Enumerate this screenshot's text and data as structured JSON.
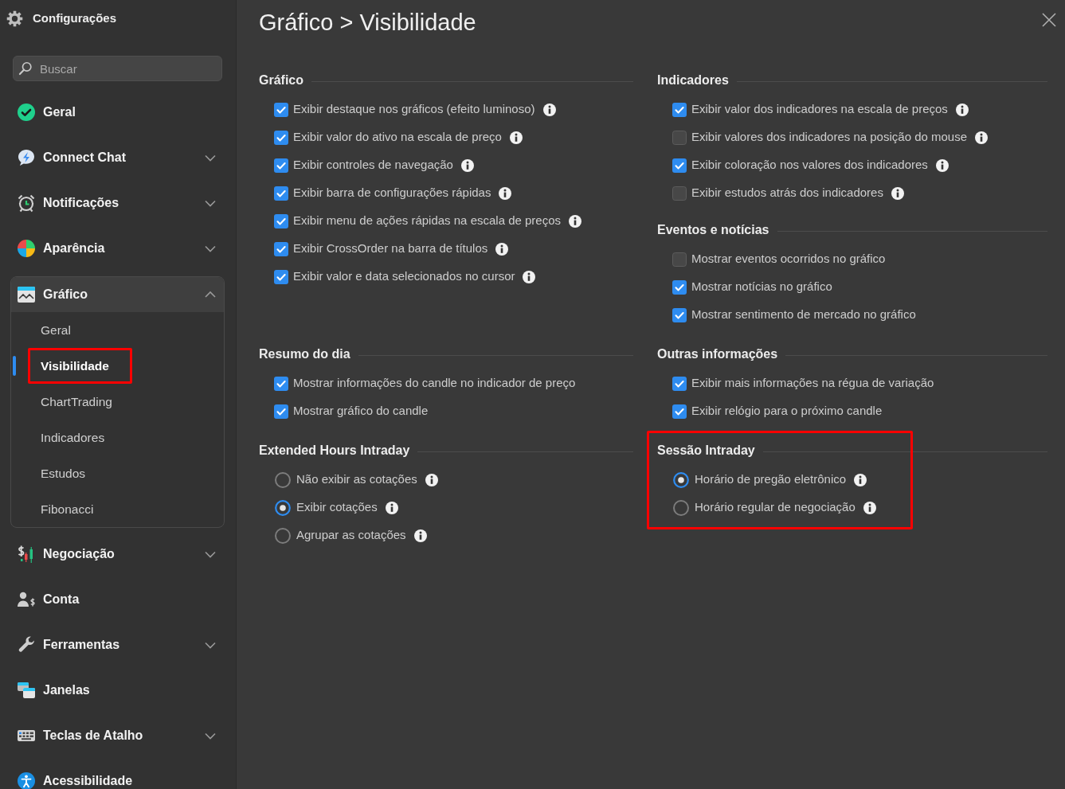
{
  "sidebar": {
    "title": "Configurações",
    "search": {
      "placeholder": "Buscar"
    },
    "items": [
      {
        "label": "Geral",
        "expandable": false,
        "expanded": false
      },
      {
        "label": "Connect Chat",
        "expandable": true,
        "expanded": false
      },
      {
        "label": "Notificações",
        "expandable": true,
        "expanded": false
      },
      {
        "label": "Aparência",
        "expandable": true,
        "expanded": false
      },
      {
        "label": "Gráfico",
        "expandable": true,
        "expanded": true,
        "children": [
          {
            "label": "Geral",
            "selected": false,
            "highlighted": false
          },
          {
            "label": "Visibilidade",
            "selected": true,
            "highlighted": true
          },
          {
            "label": "ChartTrading",
            "selected": false,
            "highlighted": false
          },
          {
            "label": "Indicadores",
            "selected": false,
            "highlighted": false
          },
          {
            "label": "Estudos",
            "selected": false,
            "highlighted": false
          },
          {
            "label": "Fibonacci",
            "selected": false,
            "highlighted": false
          }
        ]
      },
      {
        "label": "Negociação",
        "expandable": true,
        "expanded": false
      },
      {
        "label": "Conta",
        "expandable": false,
        "expanded": false
      },
      {
        "label": "Ferramentas",
        "expandable": true,
        "expanded": false
      },
      {
        "label": "Janelas",
        "expandable": false,
        "expanded": false
      },
      {
        "label": "Teclas de Atalho",
        "expandable": true,
        "expanded": false
      },
      {
        "label": "Acessibilidade",
        "expandable": false,
        "expanded": false
      }
    ]
  },
  "page": {
    "title": "Gráfico > Visibilidade",
    "rows": [
      {
        "left": [
          {
            "title": "Gráfico",
            "highlighted": false,
            "options": [
              {
                "kind": "checkbox",
                "label": "Exibir destaque nos gráficos (efeito luminoso)",
                "checked": true,
                "info": true
              },
              {
                "kind": "checkbox",
                "label": "Exibir valor do ativo na escala de preço",
                "checked": true,
                "info": true
              },
              {
                "kind": "checkbox",
                "label": "Exibir controles de navegação",
                "checked": true,
                "info": true
              },
              {
                "kind": "checkbox",
                "label": "Exibir barra de configurações rápidas",
                "checked": true,
                "info": true
              },
              {
                "kind": "checkbox",
                "label": "Exibir menu de ações rápidas na escala de preços",
                "checked": true,
                "info": true
              },
              {
                "kind": "checkbox",
                "label": "Exibir CrossOrder na barra de títulos",
                "checked": true,
                "info": true
              },
              {
                "kind": "checkbox",
                "label": "Exibir valor e data selecionados no cursor",
                "checked": true,
                "info": true
              }
            ]
          }
        ],
        "right": [
          {
            "title": "Indicadores",
            "highlighted": false,
            "options": [
              {
                "kind": "checkbox",
                "label": "Exibir valor dos indicadores na escala de preços",
                "checked": true,
                "info": true
              },
              {
                "kind": "checkbox",
                "label": "Exibir valores dos indicadores na posição do mouse",
                "checked": false,
                "info": true
              },
              {
                "kind": "checkbox",
                "label": "Exibir coloração nos valores dos indicadores",
                "checked": true,
                "info": true
              },
              {
                "kind": "checkbox",
                "label": "Exibir estudos atrás dos indicadores",
                "checked": false,
                "info": true
              }
            ]
          },
          {
            "title": "Eventos e notícias",
            "highlighted": false,
            "options": [
              {
                "kind": "checkbox",
                "label": "Mostrar eventos ocorridos no gráfico",
                "checked": false,
                "info": false
              },
              {
                "kind": "checkbox",
                "label": "Mostrar notícias no gráfico",
                "checked": true,
                "info": false
              },
              {
                "kind": "checkbox",
                "label": "Mostrar sentimento de mercado no gráfico",
                "checked": true,
                "info": false
              }
            ]
          }
        ]
      },
      {
        "left": [
          {
            "title": "Resumo do dia",
            "highlighted": false,
            "options": [
              {
                "kind": "checkbox",
                "label": "Mostrar informações do candle no indicador de preço",
                "checked": true,
                "info": false
              },
              {
                "kind": "checkbox",
                "label": "Mostrar gráfico do candle",
                "checked": true,
                "info": false
              }
            ]
          }
        ],
        "right": [
          {
            "title": "Outras informações",
            "highlighted": false,
            "options": [
              {
                "kind": "checkbox",
                "label": "Exibir mais informações na régua de variação",
                "checked": true,
                "info": false
              },
              {
                "kind": "checkbox",
                "label": "Exibir relógio para o próximo candle",
                "checked": true,
                "info": false
              }
            ]
          }
        ]
      },
      {
        "left": [
          {
            "title": "Extended Hours Intraday",
            "highlighted": false,
            "options": [
              {
                "kind": "radio",
                "label": "Não exibir as cotações",
                "selected": false,
                "info": true
              },
              {
                "kind": "radio",
                "label": "Exibir cotações",
                "selected": true,
                "info": true
              },
              {
                "kind": "radio",
                "label": "Agrupar as cotações",
                "selected": false,
                "info": true
              }
            ]
          }
        ],
        "right": [
          {
            "title": "Sessão Intraday",
            "highlighted": true,
            "options": [
              {
                "kind": "radio",
                "label": "Horário de pregão eletrônico",
                "selected": true,
                "info": true
              },
              {
                "kind": "radio",
                "label": "Horário regular de negociação",
                "selected": false,
                "info": true
              }
            ]
          }
        ]
      }
    ]
  }
}
